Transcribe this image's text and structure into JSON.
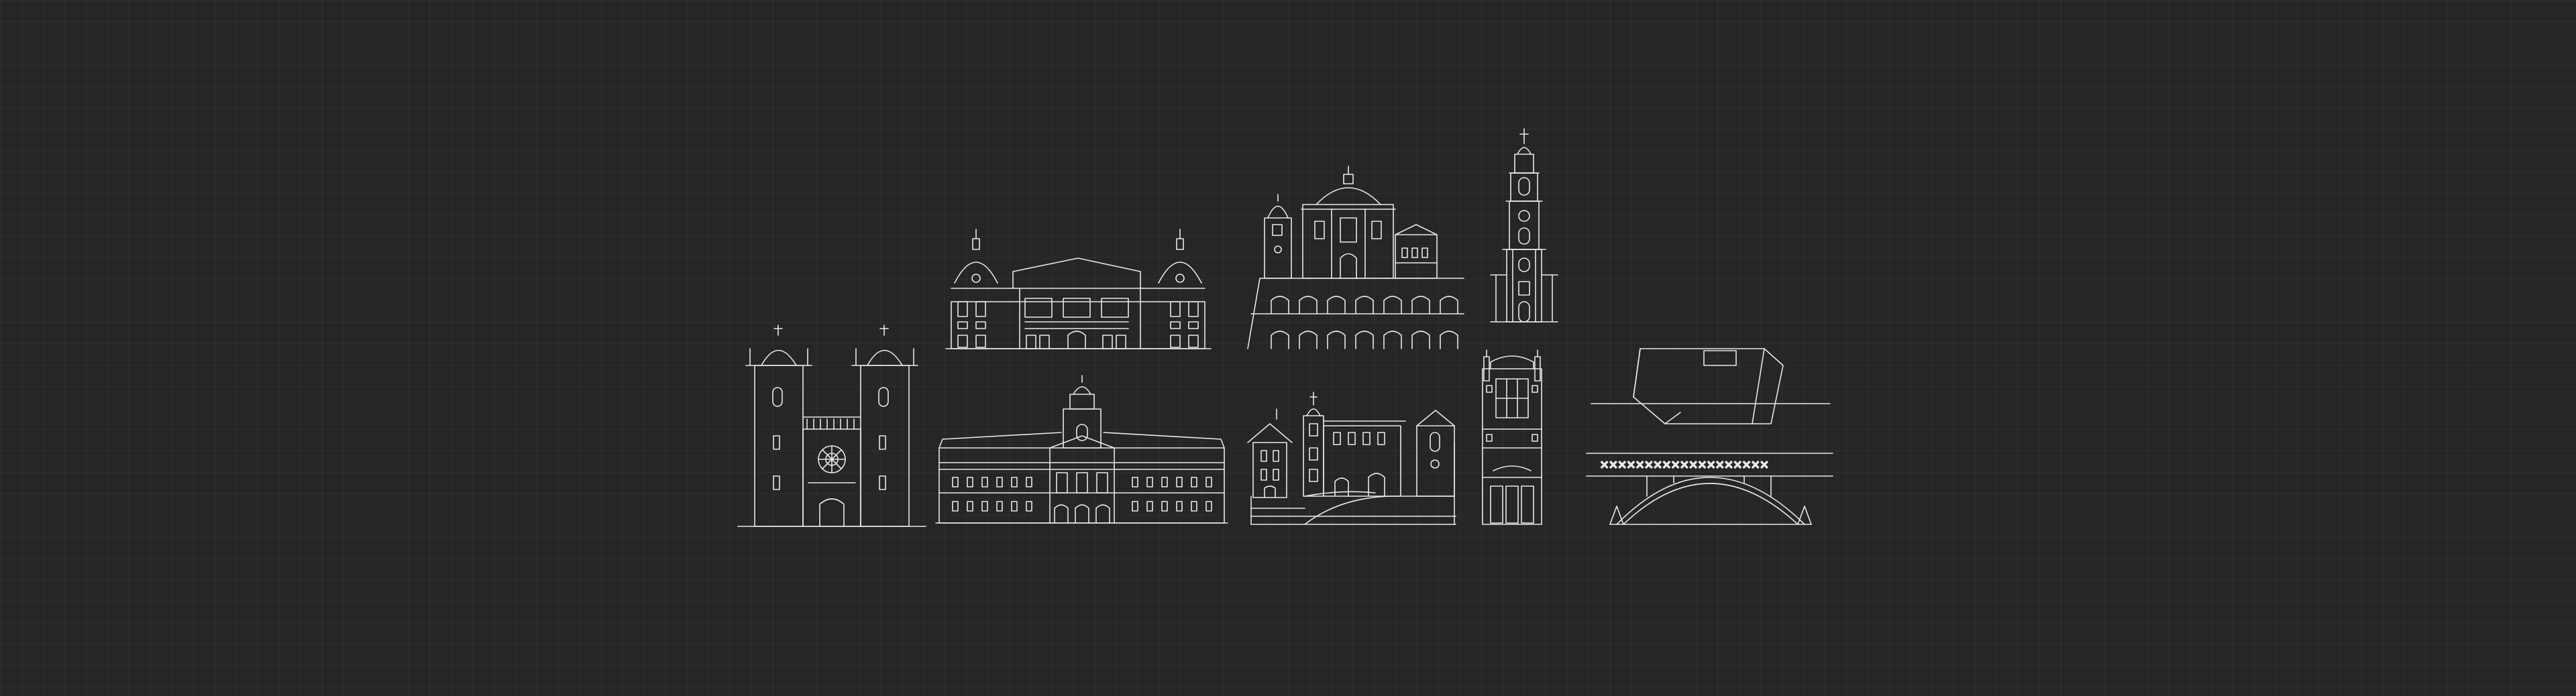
{
  "canvas": {
    "background": "#262626",
    "grid_color": "#333333",
    "line_color": "#e8e8e8"
  },
  "illustration": {
    "name": "porto-landmarks-line-art",
    "landmark_count": 10
  }
}
